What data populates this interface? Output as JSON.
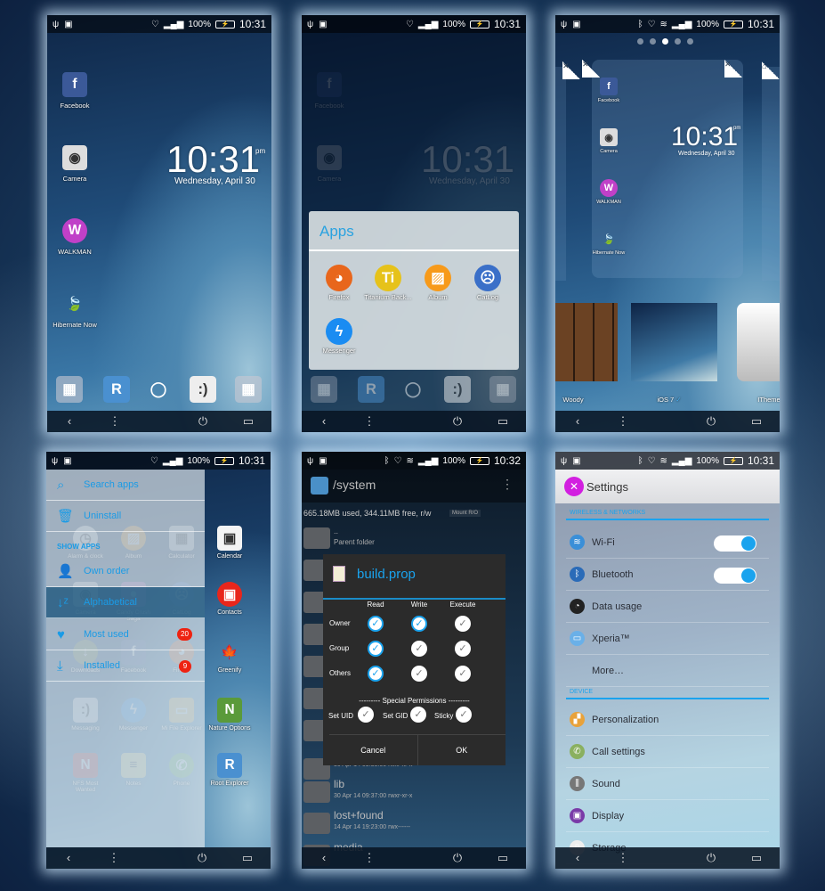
{
  "status": {
    "battery": "100%",
    "time_a": "10:31",
    "time_b": "10:32"
  },
  "nav": {
    "back": "‹",
    "menu": "⋮",
    "home": "",
    "power": "⏻",
    "recents": "▭"
  },
  "screen1": {
    "apps": [
      {
        "label": "Facebook",
        "icon": "facebook-icon"
      },
      {
        "label": "Camera",
        "icon": "camera-icon"
      },
      {
        "label": "WALKMAN",
        "icon": "walkman-icon"
      },
      {
        "label": "Hibernate Now",
        "icon": "hibernate-icon"
      }
    ],
    "clock": {
      "time": "10:31",
      "ampm": "pm",
      "date": "Wednesday, April 30"
    },
    "dock": [
      {
        "icon": "folder-icon"
      },
      {
        "icon": "root-explorer-icon"
      },
      {
        "icon": "home-button-icon"
      },
      {
        "icon": "messaging-icon"
      },
      {
        "icon": "games-folder-icon"
      }
    ]
  },
  "screen2": {
    "folder": {
      "title": "Apps",
      "apps": [
        {
          "label": "Firefox",
          "icon": "firefox-icon"
        },
        {
          "label": "Titanium Back...",
          "icon": "titanium-icon"
        },
        {
          "label": "Album",
          "icon": "album-icon"
        },
        {
          "label": "CatLog",
          "icon": "catlog-icon"
        },
        {
          "label": "Messenger",
          "icon": "messenger-icon"
        }
      ]
    }
  },
  "screen3": {
    "page_dots": 5,
    "active_dot": 2,
    "themes": [
      {
        "label": "Woody",
        "color": "#6b4223"
      },
      {
        "label": "iOS 7",
        "selected": true,
        "color": "#2b5e8e"
      },
      {
        "label": "ITheme",
        "color": "#dddddd"
      }
    ],
    "check": "✓"
  },
  "screen4": {
    "menu": {
      "search": "Search apps",
      "uninstall": "Uninstall",
      "section": "SHOW APPS",
      "own_order": "Own order",
      "alphabetical": "Alphabetical",
      "most_used": "Most used",
      "installed": "Installed"
    },
    "grid": [
      {
        "label": "Alarm & clock",
        "icon": "clock-icon"
      },
      {
        "label": "Album",
        "icon": "album-icon"
      },
      {
        "label": "Calculator",
        "icon": "calculator-icon"
      },
      {
        "label": "Camera",
        "icon": "camera-icon"
      },
      {
        "label": "Candy Crush Saga",
        "icon": "candy-crush-icon"
      },
      {
        "label": "CatLog",
        "icon": "catlog-icon"
      },
      {
        "label": "Downloads",
        "icon": "download-icon"
      },
      {
        "label": "Facebook",
        "icon": "facebook-icon"
      },
      {
        "label": "Firefox",
        "icon": "firefox-icon"
      },
      {
        "label": "Messaging",
        "icon": "messaging-icon"
      },
      {
        "label": "Messenger",
        "icon": "messenger-icon"
      },
      {
        "label": "Mi File Explorer",
        "icon": "file-explorer-icon"
      },
      {
        "label": "NFS Most Wanted",
        "icon": "nfs-icon"
      },
      {
        "label": "Notes",
        "icon": "notes-icon"
      },
      {
        "label": "Phone",
        "icon": "phone-icon"
      }
    ],
    "badges": [
      "20",
      "9"
    ],
    "right": [
      {
        "label": "Calendar",
        "icon": "calendar-icon"
      },
      {
        "label": "Contacts",
        "icon": "contacts-icon"
      },
      {
        "label": "Greenify",
        "icon": "greenify-icon"
      },
      {
        "label": "Nature Options",
        "icon": "nature-options-icon"
      },
      {
        "label": "Root Explorer",
        "icon": "root-explorer-icon"
      }
    ]
  },
  "screen5": {
    "path": "/system",
    "storage": "665.18MB used, 344.11MB free, r/w",
    "mount": "Mount R/O",
    "parent": "..",
    "parent_label": "Parent folder",
    "dialog": {
      "title": "build.prop",
      "columns": [
        "Read",
        "Write",
        "Execute"
      ],
      "rows": [
        {
          "label": "Owner",
          "checks": [
            true,
            true,
            false
          ]
        },
        {
          "label": "Group",
          "checks": [
            true,
            false,
            false
          ]
        },
        {
          "label": "Others",
          "checks": [
            true,
            false,
            false
          ]
        }
      ],
      "special": "--------- Special Permissions ---------",
      "set_uid": "Set UID",
      "set_gid": "Set GID",
      "sticky": "Sticky",
      "cancel": "Cancel",
      "ok": "OK"
    },
    "files": [
      {
        "name": "",
        "meta": "30 Apr 14 09:38:00  rwxr-xr-x"
      },
      {
        "name": "lib",
        "meta": "30 Apr 14 09:37:00  rwxr-xr-x"
      },
      {
        "name": "lost+found",
        "meta": "14 Apr 14 19:23:00  rwx------"
      },
      {
        "name": "media",
        "meta": ""
      }
    ]
  },
  "screen6": {
    "title": "Settings",
    "wireless": "WIRELESS & NETWORKS",
    "device": "DEVICE",
    "wireless_items": [
      {
        "label": "Wi-Fi",
        "icon": "wifi-icon",
        "toggle": true
      },
      {
        "label": "Bluetooth",
        "icon": "bluetooth-icon",
        "toggle": true
      },
      {
        "label": "Data usage",
        "icon": "data-usage-icon"
      },
      {
        "label": "Xperia™",
        "icon": "xperia-icon"
      },
      {
        "label": "More…",
        "icon": ""
      }
    ],
    "device_items": [
      {
        "label": "Personalization",
        "icon": "personalization-icon"
      },
      {
        "label": "Call settings",
        "icon": "call-settings-icon"
      },
      {
        "label": "Sound",
        "icon": "sound-icon"
      },
      {
        "label": "Display",
        "icon": "display-icon"
      },
      {
        "label": "Storage",
        "icon": "storage-icon"
      }
    ]
  }
}
